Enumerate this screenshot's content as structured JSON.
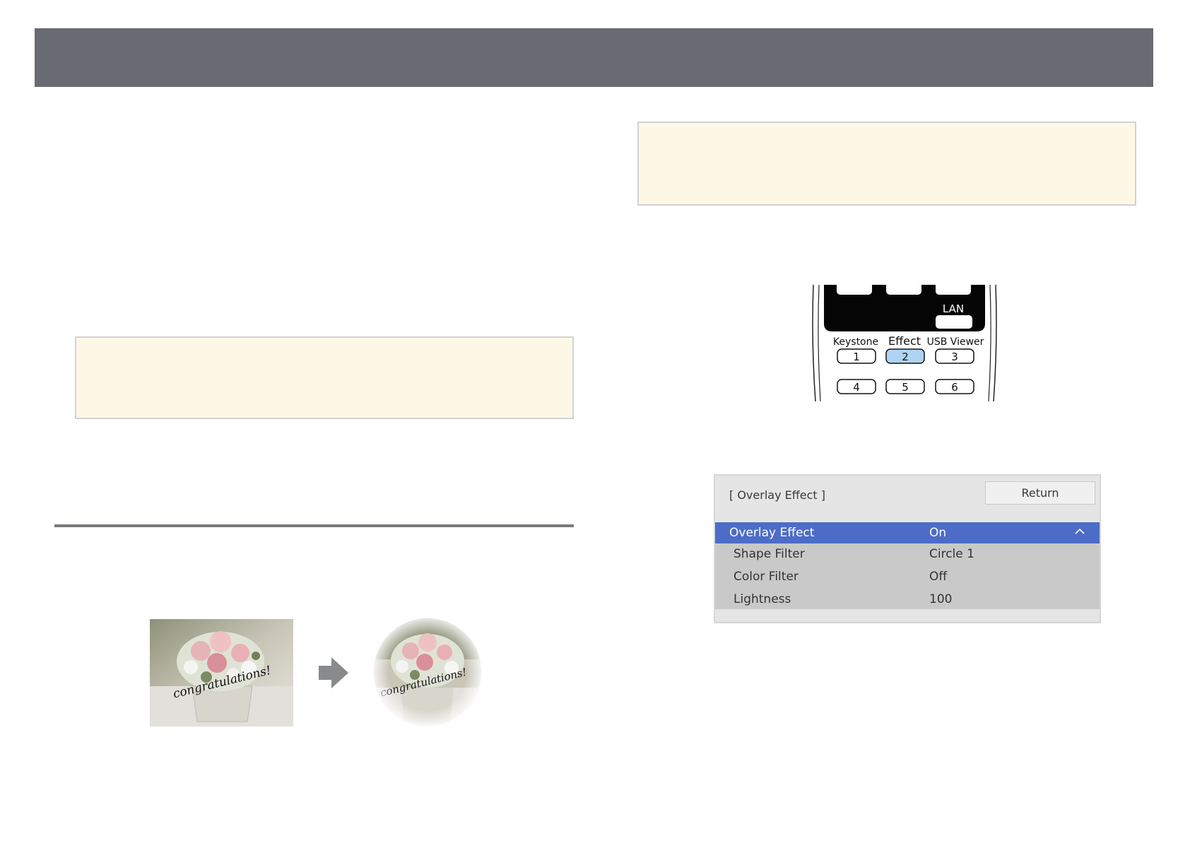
{
  "remote": {
    "lan_label": "LAN",
    "buttons": [
      {
        "name": "Keystone",
        "number": "1"
      },
      {
        "name": "Effect",
        "number": "2"
      },
      {
        "name": "USB Viewer",
        "number": "3"
      },
      {
        "name": "",
        "number": "4"
      },
      {
        "name": "",
        "number": "5"
      },
      {
        "name": "",
        "number": "6"
      }
    ],
    "highlight_color": "#aed4f1"
  },
  "example": {
    "photo_text": "congratulations!"
  },
  "menu": {
    "title": "[ Overlay Effect ]",
    "return_label": "Return",
    "selected_color": "#4c6cc8",
    "rows": [
      {
        "label": "Overlay Effect",
        "value": "On",
        "selected": true
      },
      {
        "label": "Shape Filter",
        "value": "Circle 1"
      },
      {
        "label": "Color Filter",
        "value": "Off"
      },
      {
        "label": "Lightness",
        "value": "100"
      }
    ]
  }
}
